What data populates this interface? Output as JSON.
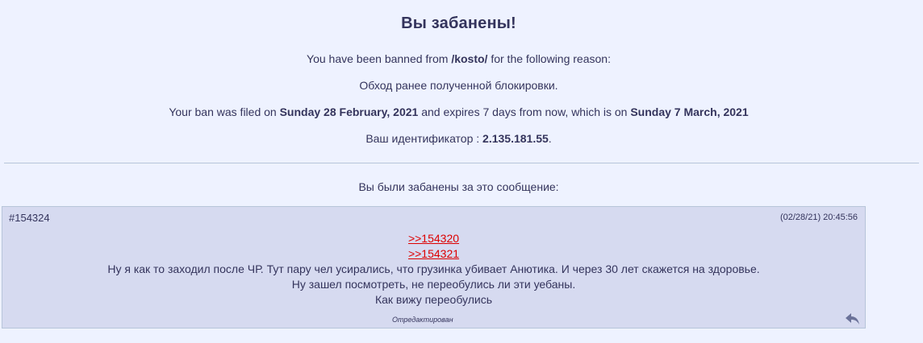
{
  "ban": {
    "title": "Вы забанены!",
    "banned_from_prefix": "You have been banned from ",
    "board": "/kosto/",
    "banned_from_suffix": " for the following reason:",
    "reason": "Обход ранее полученной блокировки.",
    "filed_prefix": "Your ban was filed on ",
    "filed_date": "Sunday 28 February, 2021",
    "filed_middle": " and expires 7 days from now, which is on ",
    "expires_date": "Sunday 7 March, 2021",
    "id_prefix": "Ваш идентификатор : ",
    "id_value": "2.135.181.55",
    "id_suffix": "."
  },
  "post_heading": "Вы были забанены за это сообщение:",
  "post": {
    "number": "#154324",
    "date": "(02/28/21) 20:45:56",
    "quote1": ">>154320",
    "quote2": ">>154321",
    "line1": "Ну я как то заходил после ЧР. Тут пару чел усирались, что грузинка убивает Анютика. И через 30 лет скажется на здоровье.",
    "line2": "Ну зашел посмотреть, не переобулись ли эти уебаны.",
    "line3": "Как вижу переобулись",
    "edited": "Отредактирован"
  },
  "icons": {
    "reply": "reply-arrow-icon"
  },
  "colors": {
    "background": "#eef2ff",
    "post_background": "#d6daf0",
    "border": "#b7c5d9",
    "text": "#34345c",
    "quote_link": "#dd0000"
  }
}
